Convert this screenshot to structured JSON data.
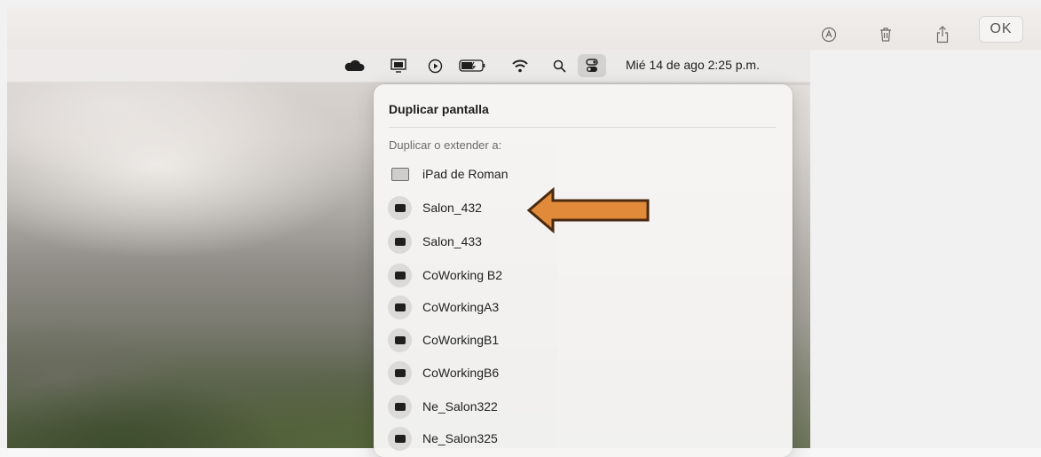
{
  "viewer_toolbar": {
    "markup_icon": "markup-pen-icon",
    "delete_icon": "trash-icon",
    "share_icon": "share-icon",
    "ok_label": "OK"
  },
  "menubar": {
    "icons": [
      "icloud-icon",
      "screen-mirroring-icon",
      "play-circle-icon",
      "battery-icon",
      "wifi-icon",
      "search-icon",
      "control-center-icon"
    ],
    "datetime": "Mié 14 de ago  2:25 p.m."
  },
  "panel": {
    "title": "Duplicar pantalla",
    "subtitle": "Duplicar o extender a:",
    "devices": [
      {
        "label": "iPad de Roman",
        "type": "ipad"
      },
      {
        "label": "Salon_432",
        "type": "appletv"
      },
      {
        "label": "Salon_433",
        "type": "appletv"
      },
      {
        "label": "CoWorking B2",
        "type": "appletv"
      },
      {
        "label": "CoWorkingA3",
        "type": "appletv"
      },
      {
        "label": "CoWorkingB1",
        "type": "appletv"
      },
      {
        "label": "CoWorkingB6",
        "type": "appletv"
      },
      {
        "label": "Ne_Salon322",
        "type": "appletv"
      },
      {
        "label": "Ne_Salon325",
        "type": "appletv"
      }
    ]
  },
  "annotation": {
    "arrow_color": "#e08a3a",
    "arrow_outline": "#4a2a10"
  }
}
